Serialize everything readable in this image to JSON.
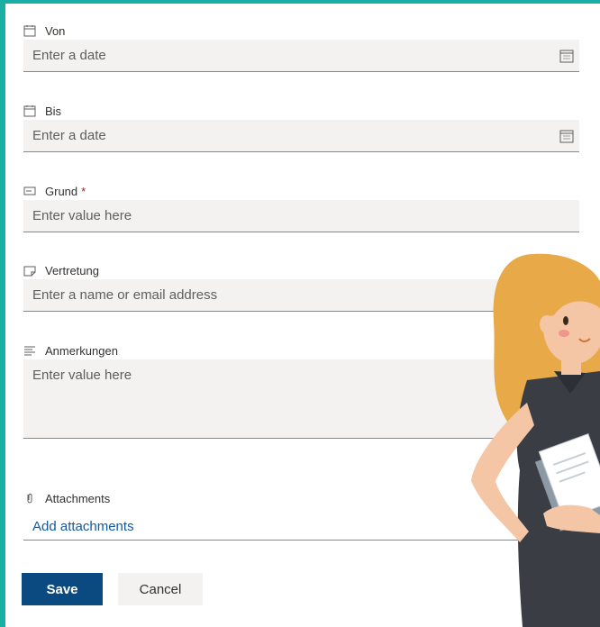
{
  "fields": {
    "von": {
      "label": "Von",
      "placeholder": "Enter a date"
    },
    "bis": {
      "label": "Bis",
      "placeholder": "Enter a date"
    },
    "grund": {
      "label": "Grund",
      "required_mark": "*",
      "placeholder": "Enter value here"
    },
    "vertretung": {
      "label": "Vertretung",
      "placeholder": "Enter a name or email address"
    },
    "anmerkungen": {
      "label": "Anmerkungen",
      "placeholder": "Enter value here"
    }
  },
  "attachments": {
    "label": "Attachments",
    "link": "Add attachments"
  },
  "buttons": {
    "save": "Save",
    "cancel": "Cancel"
  },
  "colors": {
    "accent_frame": "#1aaea4",
    "primary_button": "#0b4a80",
    "link": "#0f5aa6"
  }
}
